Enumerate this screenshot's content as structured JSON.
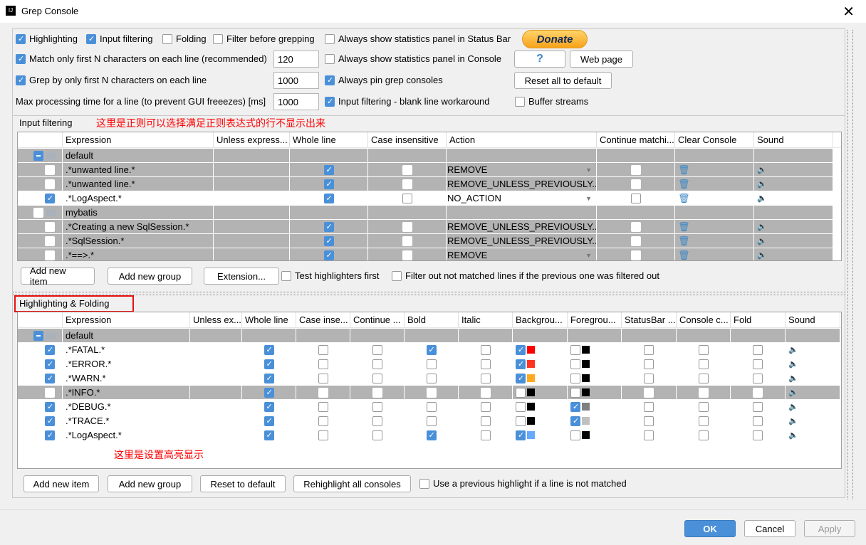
{
  "window": {
    "title": "Grep Console"
  },
  "options": {
    "highlighting": {
      "label": "Highlighting",
      "checked": true
    },
    "input_filtering": {
      "label": "Input filtering",
      "checked": true
    },
    "folding": {
      "label": "Folding",
      "checked": false
    },
    "filter_before": {
      "label": "Filter before grepping",
      "checked": false
    },
    "stats_status": {
      "label": "Always show statistics panel in Status Bar",
      "checked": false
    },
    "match_first_n": {
      "label": "Match only first N characters on each line (recommended)",
      "checked": true,
      "value": "120"
    },
    "stats_console": {
      "label": "Always show statistics panel in Console",
      "checked": false
    },
    "grep_first_n": {
      "label": "Grep by only first N characters on each line",
      "checked": true,
      "value": "1000"
    },
    "pin_consoles": {
      "label": "Always pin grep consoles",
      "checked": true
    },
    "max_time": {
      "label": "Max processing time for a line (to prevent GUI freeezes) [ms]",
      "value": "1000"
    },
    "blank_workaround": {
      "label": "Input filtering - blank line workaround",
      "checked": true
    },
    "buffer_streams": {
      "label": "Buffer streams",
      "checked": false
    }
  },
  "buttons": {
    "donate": "Donate",
    "help": "?",
    "web_page": "Web page",
    "reset_all": "Reset all to default",
    "ok": "OK",
    "cancel": "Cancel",
    "apply": "Apply"
  },
  "input_filtering": {
    "title": "Input filtering",
    "annotation": "这里是正则可以选择满足正则表达式的行不显示出来",
    "columns": [
      "",
      "Expression",
      "Unless express...",
      "Whole line",
      "Case insensitive",
      "Action",
      "Continue matchi...",
      "Clear Console",
      "Sound"
    ],
    "rows": [
      {
        "group": true,
        "enabled": "minus",
        "expr": "default"
      },
      {
        "enabled": false,
        "expr": ".*unwanted line.*",
        "whole": true,
        "case": false,
        "action": "REMOVE",
        "cont": false
      },
      {
        "enabled": false,
        "expr": ".*unwanted line.*",
        "whole": true,
        "case": false,
        "action": "REMOVE_UNLESS_PREVIOUSLY...",
        "cont": false
      },
      {
        "enabled": true,
        "expr": ".*LogAspect.*",
        "whole": true,
        "case": false,
        "action": "NO_ACTION",
        "cont": false
      },
      {
        "group": true,
        "enabled": false,
        "expr": "mybatis"
      },
      {
        "enabled": false,
        "expr": ".*Creating a new SqlSession.*",
        "whole": true,
        "case": false,
        "action": "REMOVE_UNLESS_PREVIOUSLY...",
        "cont": false
      },
      {
        "enabled": false,
        "expr": ".*SqlSession.*",
        "whole": true,
        "case": false,
        "action": "REMOVE_UNLESS_PREVIOUSLY...",
        "cont": false
      },
      {
        "enabled": false,
        "expr": ".*==>.*",
        "whole": true,
        "case": false,
        "action": "REMOVE",
        "cont": false
      }
    ],
    "buttons": {
      "add_item": "Add new item",
      "add_group": "Add new group",
      "extension": "Extension..."
    },
    "test_first": {
      "label": "Test highlighters first",
      "checked": false
    },
    "filter_out": {
      "label": "Filter out not matched lines if the previous one was filtered out",
      "checked": false
    }
  },
  "highlighting": {
    "title": "Highlighting & Folding",
    "annotation": "这里是设置高亮显示",
    "columns": [
      "",
      "Expression",
      "Unless ex...",
      "Whole line",
      "Case inse...",
      "Continue ...",
      "Bold",
      "Italic",
      "Backgrou...",
      "Foregrou...",
      "StatusBar ...",
      "Console c...",
      "Fold",
      "Sound"
    ],
    "rows": [
      {
        "group": true,
        "enabled": "minus",
        "expr": "default"
      },
      {
        "enabled": true,
        "expr": ".*FATAL.*",
        "whole": true,
        "bold": true,
        "bg_on": true,
        "bg": "#ff0000",
        "fg_on": false,
        "fg": "#000000"
      },
      {
        "enabled": true,
        "expr": ".*ERROR.*",
        "whole": true,
        "bold": false,
        "bg_on": true,
        "bg": "#ff3322",
        "fg_on": false,
        "fg": "#000000"
      },
      {
        "enabled": true,
        "expr": ".*WARN.*",
        "whole": true,
        "bold": false,
        "bg_on": true,
        "bg": "#ffaa22",
        "fg_on": false,
        "fg": "#000000"
      },
      {
        "enabled": false,
        "expr": ".*INFO.*",
        "whole": true,
        "bold": false,
        "bg_on": false,
        "bg": "#000000",
        "fg_on": false,
        "fg": "#000000"
      },
      {
        "enabled": true,
        "expr": ".*DEBUG.*",
        "whole": true,
        "bold": false,
        "bg_on": false,
        "bg": "#000000",
        "fg_on": true,
        "fg": "#808080"
      },
      {
        "enabled": true,
        "expr": ".*TRACE.*",
        "whole": true,
        "bold": false,
        "bg_on": false,
        "bg": "#000000",
        "fg_on": true,
        "fg": "#c0c0c0"
      },
      {
        "enabled": true,
        "expr": ".*LogAspect.*",
        "whole": true,
        "bold": true,
        "bg_on": true,
        "bg": "#66aaff",
        "fg_on": false,
        "fg": "#000000"
      }
    ],
    "buttons": {
      "add_item": "Add new item",
      "add_group": "Add new group",
      "reset": "Reset to default",
      "rehighlight": "Rehighlight all consoles"
    },
    "use_previous": {
      "label": "Use a previous highlight if a line is not matched",
      "checked": false
    }
  },
  "icons": {
    "clear": "trash-icon",
    "sound": "speaker-icon",
    "folder": "folder-icon",
    "dropdown": "chevron-down-icon"
  }
}
